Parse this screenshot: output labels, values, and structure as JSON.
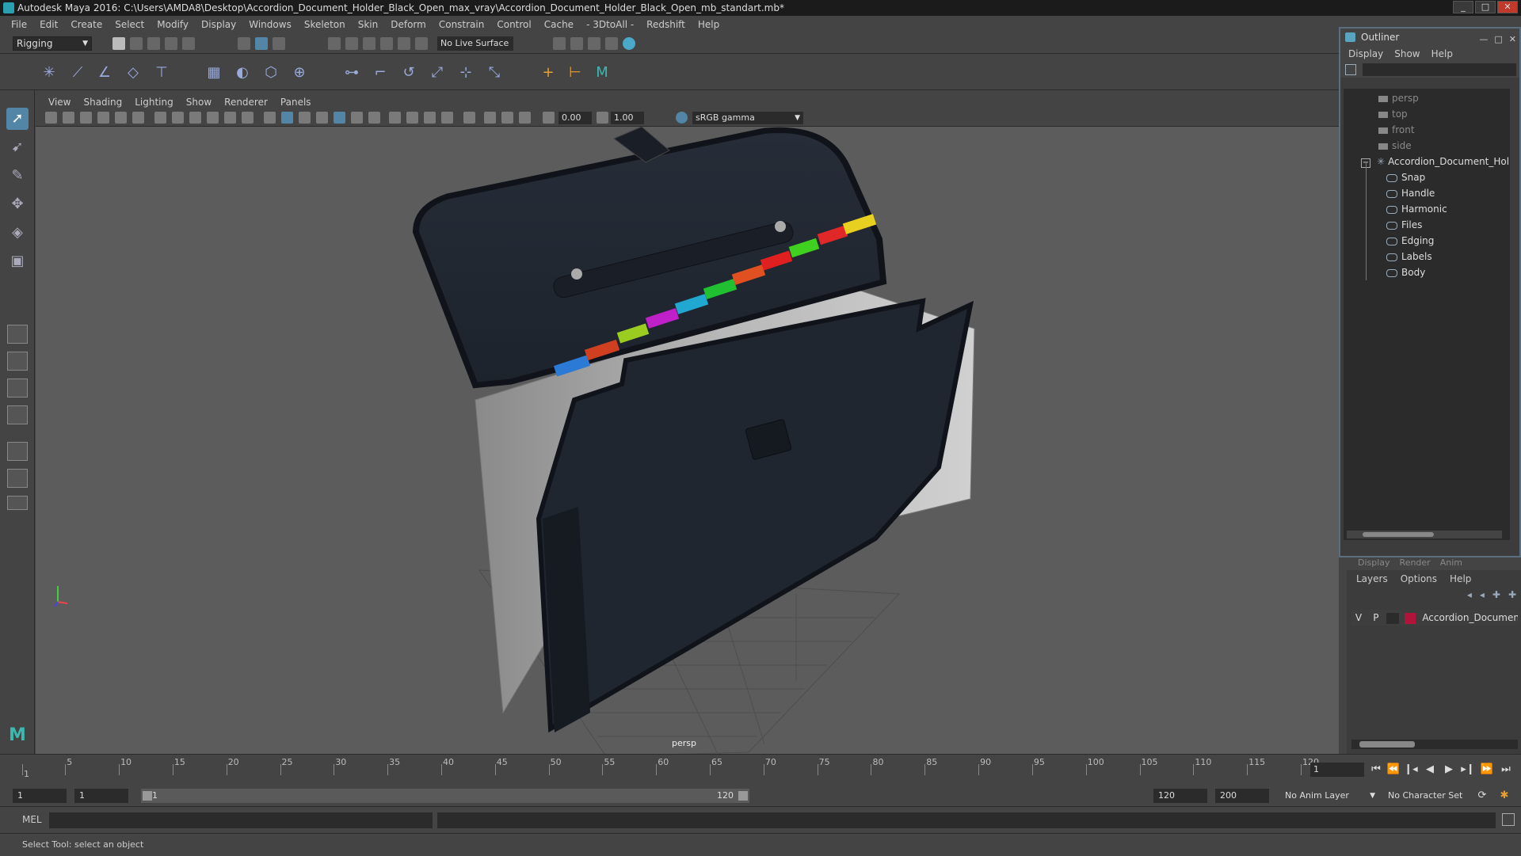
{
  "window": {
    "title": "Autodesk Maya 2016: C:\\Users\\AMDA8\\Desktop\\Accordion_Document_Holder_Black_Open_max_vray\\Accordion_Document_Holder_Black_Open_mb_standart.mb*"
  },
  "menubar": [
    "File",
    "Edit",
    "Create",
    "Select",
    "Modify",
    "Display",
    "Windows",
    "Skeleton",
    "Skin",
    "Deform",
    "Constrain",
    "Control",
    "Cache",
    "- 3DtoAll -",
    "Redshift",
    "Help"
  ],
  "statusline": {
    "mode": "Rigging",
    "live_surface": "No Live Surface"
  },
  "panel": {
    "menu": [
      "View",
      "Shading",
      "Lighting",
      "Show",
      "Renderer",
      "Panels"
    ],
    "field1": "0.00",
    "field2": "1.00",
    "color_space": "sRGB gamma",
    "camera": "persp"
  },
  "outliner": {
    "title": "Outliner",
    "menu": [
      "Display",
      "Show",
      "Help"
    ],
    "cameras": [
      "persp",
      "top",
      "front",
      "side"
    ],
    "group": "Accordion_Document_Holder",
    "children": [
      "Snap",
      "Handle",
      "Harmonic",
      "Files",
      "Edging",
      "Labels",
      "Body"
    ]
  },
  "layers": {
    "tabs": [
      "Display",
      "Render",
      "Anim"
    ],
    "menu": [
      "Layers",
      "Options",
      "Help"
    ],
    "row": {
      "v": "V",
      "p": "P",
      "name": "Accordion_Document_Holder",
      "color": "#b0143a"
    }
  },
  "timeline": {
    "ticks": [
      1,
      5,
      10,
      15,
      20,
      25,
      30,
      35,
      40,
      45,
      50,
      55,
      60,
      65,
      70,
      75,
      80,
      85,
      90,
      95,
      100,
      105,
      110,
      115,
      120
    ],
    "current": "1"
  },
  "range": {
    "start": "1",
    "start2": "1",
    "slider_start": "1",
    "slider_end": "120",
    "end": "120",
    "end2": "200",
    "anim_layer": "No Anim Layer",
    "char_set": "No Character Set"
  },
  "cmd": {
    "label": "MEL"
  },
  "help": {
    "text": "Select Tool: select an object"
  }
}
